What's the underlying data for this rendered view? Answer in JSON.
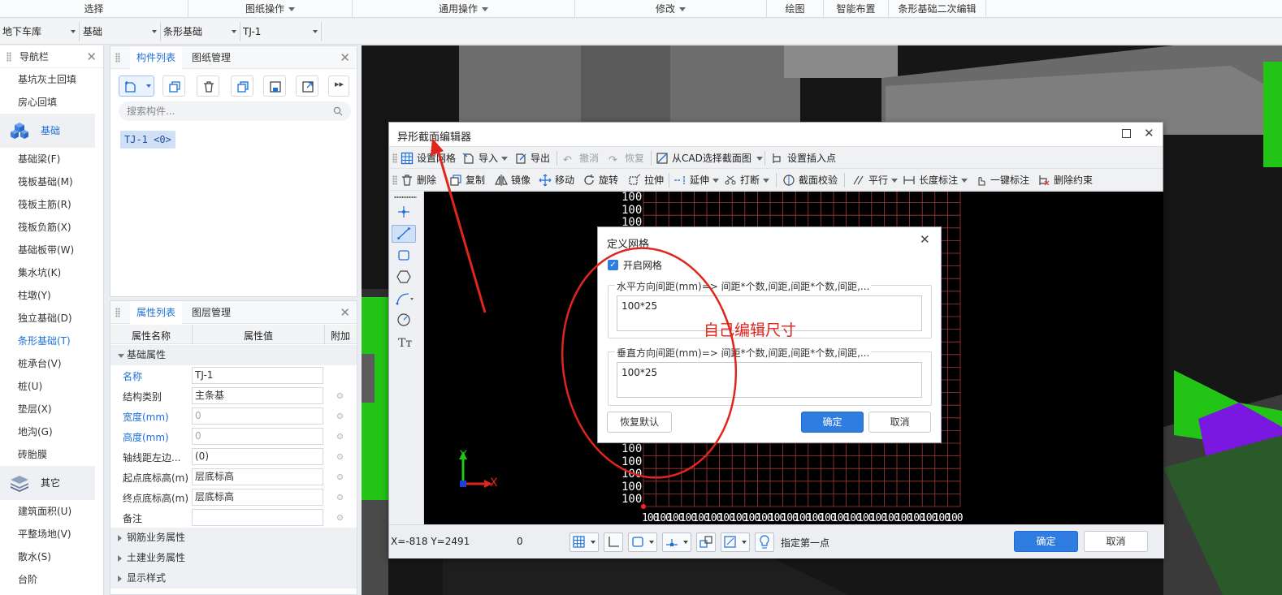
{
  "topbar": {
    "items": [
      {
        "label": "选择",
        "caret": false
      },
      {
        "label": "图纸操作",
        "caret": true
      },
      {
        "label": "通用操作",
        "caret": true
      },
      {
        "label": "修改",
        "caret": true
      },
      {
        "label": "绘图",
        "caret": false
      },
      {
        "label": "智能布置",
        "caret": false
      },
      {
        "label": "条形基础二次编辑",
        "caret": false
      }
    ]
  },
  "selectors": {
    "floor": "地下车库",
    "category": "基础",
    "type": "条形基础",
    "component": "TJ-1"
  },
  "nav": {
    "title": "导航栏",
    "items_top": [
      "基坑灰土回填",
      "房心回填"
    ],
    "section_foundation": "基础",
    "items_foundation": [
      "基础梁(F)",
      "筏板基础(M)",
      "筏板主筋(R)",
      "筏板负筋(X)",
      "基础板带(W)",
      "集水坑(K)",
      "柱墩(Y)",
      "独立基础(D)",
      "条形基础(T)",
      "桩承台(V)",
      "桩(U)",
      "垫层(X)",
      "地沟(G)",
      "砖胎膜"
    ],
    "active_item": "条形基础(T)",
    "section_other": "其它",
    "items_other": [
      "建筑面积(U)",
      "平整场地(V)",
      "散水(S)",
      "台阶"
    ]
  },
  "component_panel": {
    "tab_active": "构件列表",
    "tab_other": "图纸管理",
    "search_placeholder": "搜索构件...",
    "chip": "TJ-1 <0>"
  },
  "property_panel": {
    "tab_active": "属性列表",
    "tab_other": "图层管理",
    "col_name": "属性名称",
    "col_value": "属性值",
    "col_extra": "附加",
    "group_base": "基础属性",
    "rows": [
      {
        "name": "名称",
        "value": "TJ-1",
        "blue": true,
        "disabled": false
      },
      {
        "name": "结构类别",
        "value": "主条基",
        "blue": false,
        "disabled": false
      },
      {
        "name": "宽度(mm)",
        "value": "0",
        "blue": true,
        "disabled": true
      },
      {
        "name": "高度(mm)",
        "value": "0",
        "blue": true,
        "disabled": true
      },
      {
        "name": "轴线距左边...",
        "value": "(0)",
        "blue": false,
        "disabled": false
      },
      {
        "name": "起点底标高(m)",
        "value": "层底标高",
        "blue": false,
        "disabled": false
      },
      {
        "name": "终点底标高(m)",
        "value": "层底标高",
        "blue": false,
        "disabled": false
      },
      {
        "name": "备注",
        "value": "",
        "blue": false,
        "disabled": false
      }
    ],
    "groups_collapsed": [
      "钢筋业务属性",
      "土建业务属性",
      "显示样式"
    ]
  },
  "editor": {
    "title": "异形截面编辑器",
    "toolbar1": {
      "set_grid": "设置网格",
      "import": "导入",
      "export": "导出",
      "undo": "撤消",
      "redo": "恢复",
      "from_cad": "从CAD选择截面图",
      "set_insert": "设置插入点"
    },
    "toolbar2": {
      "delete": "删除",
      "copy": "复制",
      "mirror": "镜像",
      "move": "移动",
      "rotate": "旋转",
      "stretch": "拉伸",
      "extend": "延伸",
      "break": "打断",
      "check": "截面校验",
      "parallel": "平行",
      "length_dim": "长度标注",
      "one_key_dim": "一键标注",
      "del_constraint": "删除约束"
    },
    "ruler_label": "100",
    "axis_x": "X",
    "axis_y": "Y",
    "coords": "X=-818 Y=2491",
    "coord_value": "0",
    "hint": "指定第一点",
    "ok": "确定",
    "cancel": "取消"
  },
  "grid_dialog": {
    "title": "定义网格",
    "enable_label": "开启网格",
    "enabled": true,
    "horizontal_legend": "水平方向间距(mm)=> 间距*个数,间距,间距*个数,间距,...",
    "horizontal_value": "100*25",
    "vertical_legend": "垂直方向间距(mm)=> 间距*个数,间距,间距*个数,间距,...",
    "vertical_value": "100*25",
    "restore": "恢复默认",
    "ok": "确定",
    "cancel": "取消"
  },
  "annotation": {
    "text": "自己编辑尺寸",
    "color": "#e0261c"
  },
  "colors": {
    "accent": "#2f7de0",
    "green_solid": "#22c416",
    "purple_solid": "#7a17e0"
  }
}
